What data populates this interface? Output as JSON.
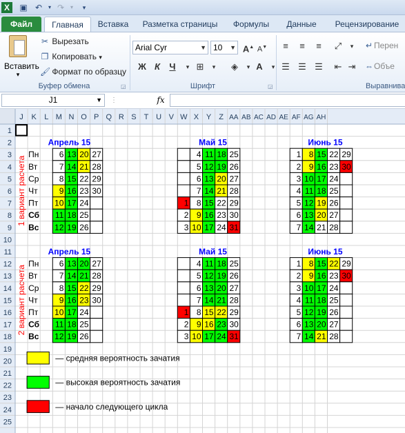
{
  "app": {
    "quick_access": [
      "excel-icon",
      "save-icon",
      "undo-icon",
      "redo-icon",
      "customize-icon"
    ]
  },
  "tabs": [
    "Файл",
    "Главная",
    "Вставка",
    "Разметка страницы",
    "Формулы",
    "Данные",
    "Рецензирование"
  ],
  "ribbon": {
    "clipboard": {
      "paste": "Вставить",
      "cut": "Вырезать",
      "copy": "Копировать",
      "format_painter": "Формат по образцу",
      "label": "Буфер обмена"
    },
    "font": {
      "name": "Arial Cyr",
      "size": "10",
      "bold": "Ж",
      "italic": "К",
      "underline": "Ч",
      "label": "Шрифт"
    },
    "alignment": {
      "wrap": "Перен",
      "merge": "Объе",
      "label": "Выравнива"
    }
  },
  "formula_bar": {
    "name_box": "J1",
    "fx": "fx",
    "value": ""
  },
  "columns": [
    "J",
    "K",
    "L",
    "M",
    "N",
    "O",
    "P",
    "Q",
    "R",
    "S",
    "T",
    "U",
    "V",
    "W",
    "X",
    "Y",
    "Z",
    "AA",
    "AB",
    "AC",
    "AD",
    "AE",
    "AF",
    "AG",
    "AH"
  ],
  "rows": [
    "1",
    "2",
    "3",
    "4",
    "5",
    "6",
    "7",
    "8",
    "9",
    "10",
    "11",
    "12",
    "13",
    "14",
    "15",
    "16",
    "17",
    "18",
    "19",
    "20",
    "21",
    "22",
    "23",
    "24",
    "25"
  ],
  "colors": {
    "yellow": "#ffff00",
    "green": "#00ff00",
    "red": "#ff0000",
    "title": "#0000ff",
    "side": "#ff0000"
  },
  "day_names": [
    "Пн",
    "Вт",
    "Ср",
    "Чт",
    "Пт",
    "Сб",
    "Вс"
  ],
  "side_labels": [
    "1 вариант расчета",
    "2 вариант расчета"
  ],
  "variants": [
    {
      "months": [
        {
          "title": "Апрель 15",
          "weeks": [
            [
              [
                "6",
                ""
              ],
              [
                "7",
                ""
              ],
              [
                "8",
                ""
              ],
              [
                "9",
                "Y"
              ],
              [
                "10",
                "Y"
              ],
              [
                "11",
                "G"
              ],
              [
                "12",
                "G"
              ]
            ],
            [
              [
                "13",
                "G"
              ],
              [
                "14",
                "G"
              ],
              [
                "15",
                "G"
              ],
              [
                "16",
                "G"
              ],
              [
                "17",
                "G"
              ],
              [
                "18",
                "G"
              ],
              [
                "19",
                "G"
              ]
            ],
            [
              [
                "20",
                "Y"
              ],
              [
                "21",
                "Y"
              ],
              [
                "22",
                ""
              ],
              [
                "23",
                ""
              ],
              [
                "24",
                ""
              ],
              [
                "25",
                ""
              ],
              [
                "26",
                ""
              ]
            ],
            [
              [
                "27",
                ""
              ],
              [
                "28",
                ""
              ],
              [
                "29",
                ""
              ],
              [
                "30",
                ""
              ],
              [
                "",
                ""
              ],
              [
                "",
                ""
              ],
              [
                "",
                ""
              ]
            ]
          ],
          "first_col": 1
        },
        {
          "title": "Май 15",
          "weeks": [
            [
              [
                "",
                ""
              ],
              [
                "",
                ""
              ],
              [
                "",
                ""
              ],
              [
                "",
                ""
              ],
              [
                "1",
                "R"
              ],
              [
                "2",
                ""
              ],
              [
                "3",
                ""
              ]
            ],
            [
              [
                "4",
                ""
              ],
              [
                "5",
                ""
              ],
              [
                "6",
                ""
              ],
              [
                "7",
                ""
              ],
              [
                "8",
                ""
              ],
              [
                "9",
                "Y"
              ],
              [
                "10",
                "Y"
              ]
            ],
            [
              [
                "11",
                "G"
              ],
              [
                "12",
                "G"
              ],
              [
                "13",
                "G"
              ],
              [
                "14",
                "G"
              ],
              [
                "15",
                "G"
              ],
              [
                "16",
                "G"
              ],
              [
                "17",
                "G"
              ]
            ],
            [
              [
                "18",
                "G"
              ],
              [
                "19",
                "G"
              ],
              [
                "20",
                "Y"
              ],
              [
                "21",
                "Y"
              ],
              [
                "22",
                ""
              ],
              [
                "23",
                ""
              ],
              [
                "24",
                ""
              ]
            ],
            [
              [
                "25",
                ""
              ],
              [
                "26",
                ""
              ],
              [
                "27",
                ""
              ],
              [
                "28",
                ""
              ],
              [
                "29",
                ""
              ],
              [
                "30",
                ""
              ],
              [
                "31",
                "R"
              ]
            ]
          ],
          "first_col": 0
        },
        {
          "title": "Июнь 15",
          "weeks": [
            [
              [
                "1",
                ""
              ],
              [
                "2",
                ""
              ],
              [
                "3",
                ""
              ],
              [
                "4",
                ""
              ],
              [
                "5",
                ""
              ],
              [
                "6",
                ""
              ],
              [
                "7",
                ""
              ]
            ],
            [
              [
                "8",
                "Y"
              ],
              [
                "9",
                "Y"
              ],
              [
                "10",
                "G"
              ],
              [
                "11",
                "G"
              ],
              [
                "12",
                "G"
              ],
              [
                "13",
                "G"
              ],
              [
                "14",
                "G"
              ]
            ],
            [
              [
                "15",
                "G"
              ],
              [
                "16",
                "G"
              ],
              [
                "17",
                "G"
              ],
              [
                "18",
                "G"
              ],
              [
                "19",
                "Y"
              ],
              [
                "20",
                "Y"
              ],
              [
                "21",
                ""
              ]
            ],
            [
              [
                "22",
                ""
              ],
              [
                "23",
                ""
              ],
              [
                "24",
                ""
              ],
              [
                "25",
                ""
              ],
              [
                "26",
                ""
              ],
              [
                "27",
                ""
              ],
              [
                "28",
                ""
              ]
            ],
            [
              [
                "29",
                ""
              ],
              [
                "30",
                "R"
              ],
              [
                "",
                ""
              ],
              [
                "",
                ""
              ],
              [
                "",
                ""
              ],
              [
                "",
                ""
              ],
              [
                "",
                ""
              ]
            ]
          ],
          "first_col": 0
        }
      ]
    },
    {
      "months": [
        {
          "title": "Апрель 15",
          "weeks": [
            [
              [
                "6",
                ""
              ],
              [
                "7",
                ""
              ],
              [
                "8",
                ""
              ],
              [
                "9",
                "Y"
              ],
              [
                "10",
                "Y"
              ],
              [
                "11",
                "G"
              ],
              [
                "12",
                "G"
              ]
            ],
            [
              [
                "13",
                "G"
              ],
              [
                "14",
                "G"
              ],
              [
                "15",
                "G"
              ],
              [
                "16",
                "G"
              ],
              [
                "17",
                "G"
              ],
              [
                "18",
                "G"
              ],
              [
                "19",
                "G"
              ]
            ],
            [
              [
                "20",
                "G"
              ],
              [
                "21",
                "G"
              ],
              [
                "22",
                "Y"
              ],
              [
                "23",
                "Y"
              ],
              [
                "24",
                ""
              ],
              [
                "25",
                ""
              ],
              [
                "26",
                ""
              ]
            ],
            [
              [
                "27",
                ""
              ],
              [
                "28",
                ""
              ],
              [
                "29",
                ""
              ],
              [
                "30",
                ""
              ],
              [
                "",
                ""
              ],
              [
                "",
                ""
              ],
              [
                "",
                ""
              ]
            ]
          ],
          "first_col": 1
        },
        {
          "title": "Май 15",
          "weeks": [
            [
              [
                "",
                ""
              ],
              [
                "",
                ""
              ],
              [
                "",
                ""
              ],
              [
                "",
                ""
              ],
              [
                "1",
                "R"
              ],
              [
                "2",
                ""
              ],
              [
                "3",
                ""
              ]
            ],
            [
              [
                "4",
                ""
              ],
              [
                "5",
                ""
              ],
              [
                "6",
                ""
              ],
              [
                "7",
                ""
              ],
              [
                "8",
                ""
              ],
              [
                "9",
                "Y"
              ],
              [
                "10",
                "Y"
              ]
            ],
            [
              [
                "11",
                "G"
              ],
              [
                "12",
                "G"
              ],
              [
                "13",
                "G"
              ],
              [
                "14",
                "G"
              ],
              [
                "15",
                "Y"
              ],
              [
                "16",
                "Y"
              ],
              [
                "17",
                "G"
              ]
            ],
            [
              [
                "18",
                "G"
              ],
              [
                "19",
                "G"
              ],
              [
                "20",
                "G"
              ],
              [
                "21",
                "G"
              ],
              [
                "22",
                "Y"
              ],
              [
                "23",
                "G"
              ],
              [
                "24",
                "G"
              ]
            ],
            [
              [
                "25",
                ""
              ],
              [
                "26",
                ""
              ],
              [
                "27",
                ""
              ],
              [
                "28",
                ""
              ],
              [
                "29",
                ""
              ],
              [
                "30",
                ""
              ],
              [
                "31",
                "R"
              ]
            ]
          ],
          "first_col": 0
        },
        {
          "title": "Июнь 15",
          "weeks": [
            [
              [
                "1",
                ""
              ],
              [
                "2",
                ""
              ],
              [
                "3",
                ""
              ],
              [
                "4",
                ""
              ],
              [
                "5",
                ""
              ],
              [
                "6",
                ""
              ],
              [
                "7",
                ""
              ]
            ],
            [
              [
                "8",
                "Y"
              ],
              [
                "9",
                "Y"
              ],
              [
                "10",
                "G"
              ],
              [
                "11",
                "G"
              ],
              [
                "12",
                "G"
              ],
              [
                "13",
                "G"
              ],
              [
                "14",
                "G"
              ]
            ],
            [
              [
                "15",
                "G"
              ],
              [
                "16",
                "G"
              ],
              [
                "17",
                "G"
              ],
              [
                "18",
                "G"
              ],
              [
                "19",
                "G"
              ],
              [
                "20",
                "G"
              ],
              [
                "21",
                "Y"
              ]
            ],
            [
              [
                "22",
                "Y"
              ],
              [
                "23",
                ""
              ],
              [
                "24",
                ""
              ],
              [
                "25",
                ""
              ],
              [
                "26",
                ""
              ],
              [
                "27",
                ""
              ],
              [
                "28",
                ""
              ]
            ],
            [
              [
                "29",
                ""
              ],
              [
                "30",
                "R"
              ],
              [
                "",
                ""
              ],
              [
                "",
                ""
              ],
              [
                "",
                ""
              ],
              [
                "",
                ""
              ],
              [
                "",
                ""
              ]
            ]
          ],
          "first_col": 0
        }
      ]
    }
  ],
  "legend": [
    {
      "color": "Y",
      "text": "— средняя вероятность зачатия"
    },
    {
      "color": "G",
      "text": "— высокая вероятность зачатия"
    },
    {
      "color": "R",
      "text": "— начало следующего цикла"
    }
  ]
}
